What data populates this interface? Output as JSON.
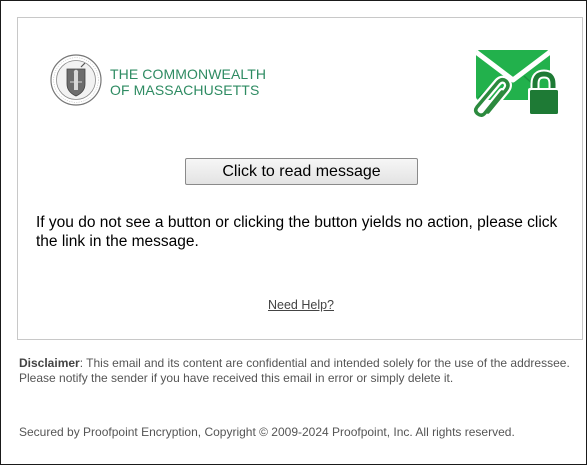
{
  "header": {
    "org_line1": "THE COMMONWEALTH",
    "org_line2": "OF MASSACHUSETTS",
    "seal_icon": "massachusetts-seal-icon",
    "secure_mail_icon": "envelope-lock-icon",
    "accent_color": "#2e8b62",
    "icon_color": "#1f9e49"
  },
  "main": {
    "read_button_label": "Click to read message",
    "instructions": "If you do not see a button or clicking the button yields no action, please click the link in the message.",
    "help_link": "Need Help?"
  },
  "footer": {
    "disclaimer_label": "Disclaimer",
    "disclaimer_text": ":  This email and its content are confidential and intended solely for the use of the addressee. Please notify the sender if you have received this email in error or simply delete it.",
    "copyright": "Secured by Proofpoint Encryption, Copyright © 2009-2024 Proofpoint, Inc. All rights reserved."
  }
}
